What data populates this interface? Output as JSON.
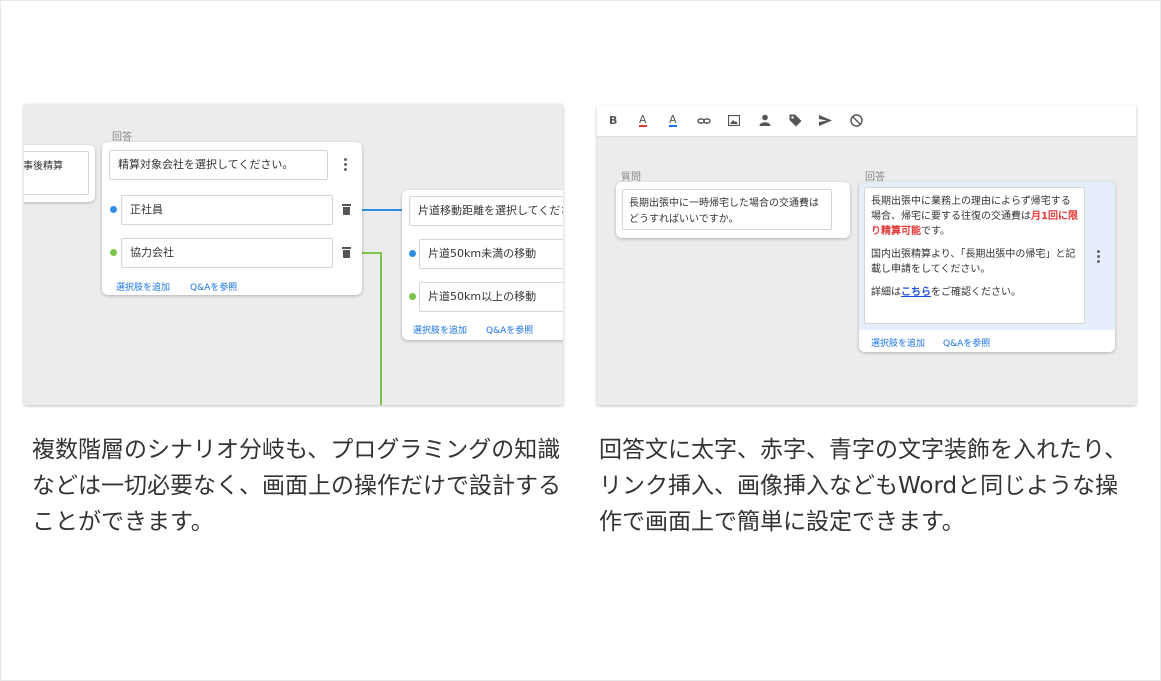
{
  "left": {
    "partial_card_text": "事後精算",
    "answer_label": "回答",
    "answer_select": "精算対象会社を選択してください。",
    "options": [
      "正社員",
      "協力会社"
    ],
    "add_option": "選択肢を追加",
    "ref_qa": "Q&Aを参照",
    "next_select": "片道移動距離を選択してくださ",
    "next_options": [
      "片道50km未満の移動",
      "片道50km以上の移動"
    ],
    "colors": {
      "blue": "#2d8fe3",
      "green": "#7cc44a"
    }
  },
  "right": {
    "toolbar": [
      "B",
      "A",
      "A",
      "link-icon",
      "image-icon",
      "person-icon",
      "tag-icon",
      "send-icon",
      "block-icon"
    ],
    "question_label": "質問",
    "question_text": "長期出張中に一時帰宅した場合の交通費はどうすればいいですか。",
    "answer_label": "回答",
    "answer_p1_a": "長期出張中に業務上の理由によらず帰宅する場合、帰宅に要する往復の交通費は",
    "answer_p1_red": "月1回に限り精算可能",
    "answer_p1_b": "です。",
    "answer_p2": "国内出張精算より、「長期出張中の帰宅」と記載し申請をしてください。",
    "answer_p3_a": "詳細は",
    "answer_p3_link": "こちら",
    "answer_p3_b": "をご確認ください。",
    "add_option": "選択肢を追加",
    "ref_qa": "Q&Aを参照"
  },
  "captions": {
    "left": "複数階層のシナリオ分岐も、プログラミングの知識などは一切必要なく、画面上の操作だけで設計することができます。",
    "right": "回答文に太字、赤字、青字の文字装飾を入れたり、リンク挿入、画像挿入などもWordと同じような操作で画面上で簡単に設定できます。"
  }
}
